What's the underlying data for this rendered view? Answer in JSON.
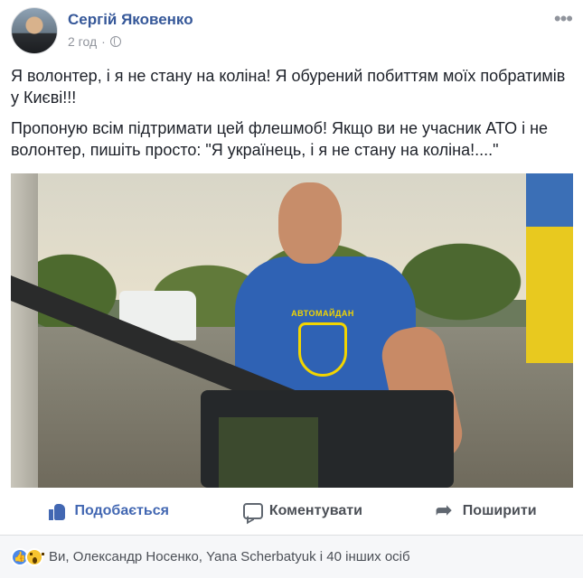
{
  "post": {
    "author": "Сергій Яковенко",
    "time": "2 год",
    "dot": "·",
    "more": "•••",
    "paragraphs": [
      "Я волонтер, і я не стану на коліна! Я обурений побиттям моїх побратимів у Києві!!!",
      "Пропоную всім підтримати цей флешмоб! Якщо ви не учасник АТО і не волонтер, пишіть просто: \"Я українець, і я не стану на коліна!....\""
    ],
    "photo_shirt_text": "АВТОМАЙДАН"
  },
  "actions": {
    "like": "Подобається",
    "comment": "Коментувати",
    "share": "Поширити"
  },
  "reactions": {
    "summary": "Ви, Олександр Носенко, Yana Scherbatyuk і 40 інших осіб"
  },
  "icons": {
    "like": "like-icon",
    "comment": "comment-icon",
    "share": "share-icon",
    "globe": "globe-icon",
    "wow": "wow-reaction-icon"
  },
  "colors": {
    "link": "#365899",
    "liked": "#4267b2",
    "muted": "#90949c"
  }
}
